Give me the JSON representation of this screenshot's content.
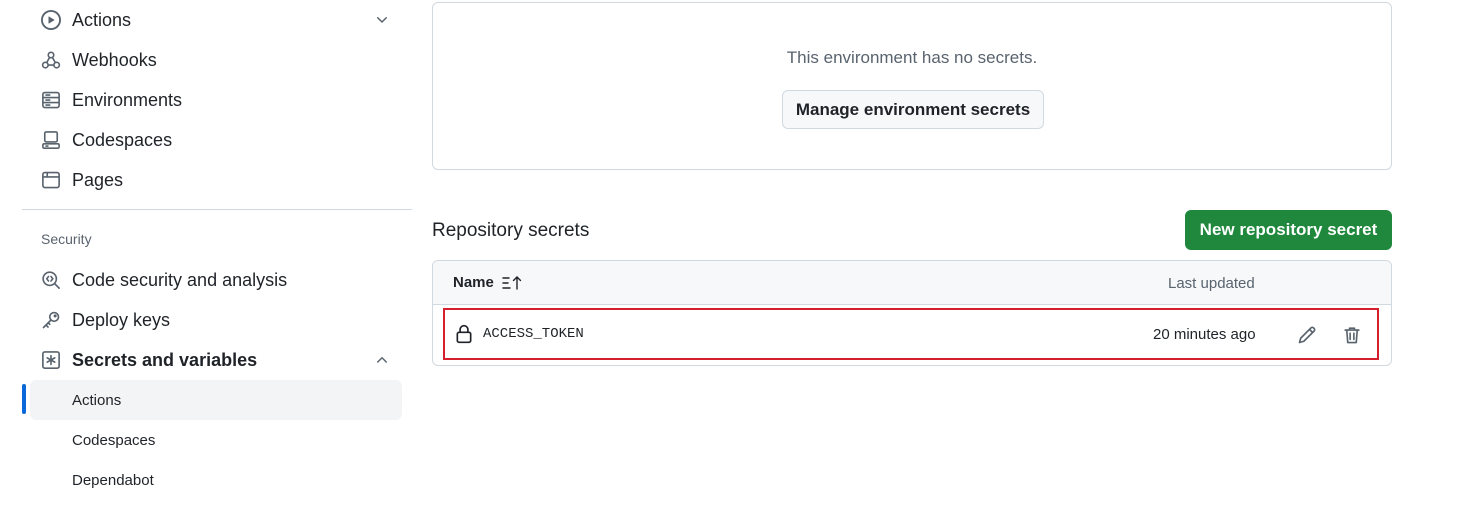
{
  "sidebar": {
    "items": [
      {
        "label": "Actions",
        "icon": "play-icon"
      },
      {
        "label": "Webhooks",
        "icon": "webhook-icon"
      },
      {
        "label": "Environments",
        "icon": "server-icon"
      },
      {
        "label": "Codespaces",
        "icon": "codespaces-icon"
      },
      {
        "label": "Pages",
        "icon": "browser-icon"
      }
    ],
    "section_heading": "Security",
    "security_items": [
      {
        "label": "Code security and analysis",
        "icon": "codescan-icon"
      },
      {
        "label": "Deploy keys",
        "icon": "key-icon"
      },
      {
        "label": "Secrets and variables",
        "icon": "asterisk-icon"
      }
    ],
    "sub_items": [
      {
        "label": "Actions",
        "active": true
      },
      {
        "label": "Codespaces",
        "active": false
      },
      {
        "label": "Dependabot",
        "active": false
      }
    ]
  },
  "environment": {
    "empty_text": "This environment has no secrets.",
    "manage_button": "Manage environment secrets"
  },
  "repository_secrets": {
    "title": "Repository secrets",
    "new_button": "New repository secret",
    "columns": {
      "name": "Name",
      "updated": "Last updated"
    },
    "rows": [
      {
        "name": "ACCESS_TOKEN",
        "updated": "20 minutes ago"
      }
    ]
  },
  "colors": {
    "accent": "#0969da",
    "primary_button": "#1f883d",
    "highlight_border": "#d4202c"
  }
}
